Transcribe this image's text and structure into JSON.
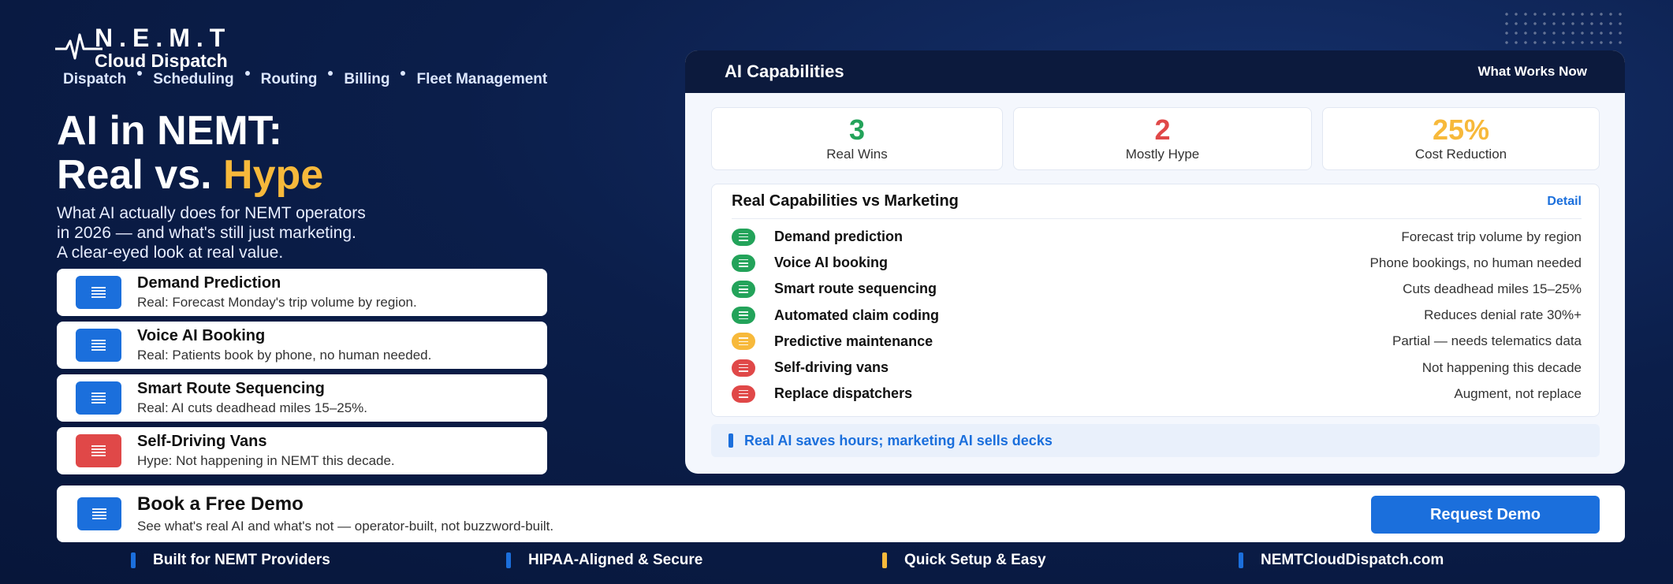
{
  "brand": {
    "name": "N.E.M.T",
    "subtitle": "Cloud Dispatch"
  },
  "nav": [
    "Dispatch",
    "Scheduling",
    "Routing",
    "Billing",
    "Fleet Management"
  ],
  "hero": {
    "title_line1": "AI in NEMT:",
    "title_line2_prefix": "Real vs. ",
    "title_line2_highlight": "Hype",
    "intro_lines": [
      "What AI actually does for NEMT operators",
      "in 2026 — and what's still just marketing.",
      "A clear-eyed look at real value."
    ]
  },
  "cards": [
    {
      "title": "Demand Prediction",
      "desc": "Real: Forecast Monday's trip volume by region.",
      "icon": "list-icon",
      "color": "#1b6fdc"
    },
    {
      "title": "Voice AI Booking",
      "desc": "Real: Patients book by phone, no human needed.",
      "icon": "list-icon",
      "color": "#1b6fdc"
    },
    {
      "title": "Smart Route Sequencing",
      "desc": "Real: AI cuts deadhead miles 15–25%.",
      "icon": "list-icon",
      "color": "#1b6fdc"
    },
    {
      "title": "Self-Driving Vans",
      "desc": "Hype: Not happening in NEMT this decade.",
      "icon": "list-icon",
      "color": "#e04848"
    }
  ],
  "panel": {
    "title": "AI Capabilities",
    "tag": "What Works Now",
    "stats": [
      {
        "value": "3",
        "label": "Real Wins",
        "color": "#23a35a"
      },
      {
        "value": "2",
        "label": "Mostly Hype",
        "color": "#e04848"
      },
      {
        "value": "25%",
        "label": "Cost Reduction",
        "color": "#f7b93b"
      }
    ],
    "table": {
      "title": "Real Capabilities vs Marketing",
      "link": "Detail",
      "rows": [
        {
          "name": "Demand prediction",
          "desc": "Forecast trip volume by region",
          "status_color": "#23a35a"
        },
        {
          "name": "Voice AI booking",
          "desc": "Phone bookings, no human needed",
          "status_color": "#23a35a"
        },
        {
          "name": "Smart route sequencing",
          "desc": "Cuts deadhead miles 15–25%",
          "status_color": "#23a35a"
        },
        {
          "name": "Automated claim coding",
          "desc": "Reduces denial rate 30%+",
          "status_color": "#23a35a"
        },
        {
          "name": "Predictive maintenance",
          "desc": "Partial — needs telematics data",
          "status_color": "#f7b93b"
        },
        {
          "name": "Self-driving vans",
          "desc": "Not happening this decade",
          "status_color": "#e04848"
        },
        {
          "name": "Replace dispatchers",
          "desc": "Augment, not replace",
          "status_color": "#e04848"
        }
      ]
    },
    "callout": "Real AI saves hours; marketing AI sells decks"
  },
  "demo": {
    "title": "Book a Free Demo",
    "desc": "See what's real AI and what's not — operator-built, not buzzword-built.",
    "button": "Request Demo"
  },
  "footer": [
    {
      "text": "Built for NEMT Providers",
      "color": "#1b6fdc"
    },
    {
      "text": "HIPAA-Aligned & Secure",
      "color": "#1b6fdc"
    },
    {
      "text": "Quick Setup & Easy",
      "color": "#f7b93b"
    },
    {
      "text": "NEMTCloudDispatch.com",
      "color": "#1b6fdc"
    }
  ]
}
